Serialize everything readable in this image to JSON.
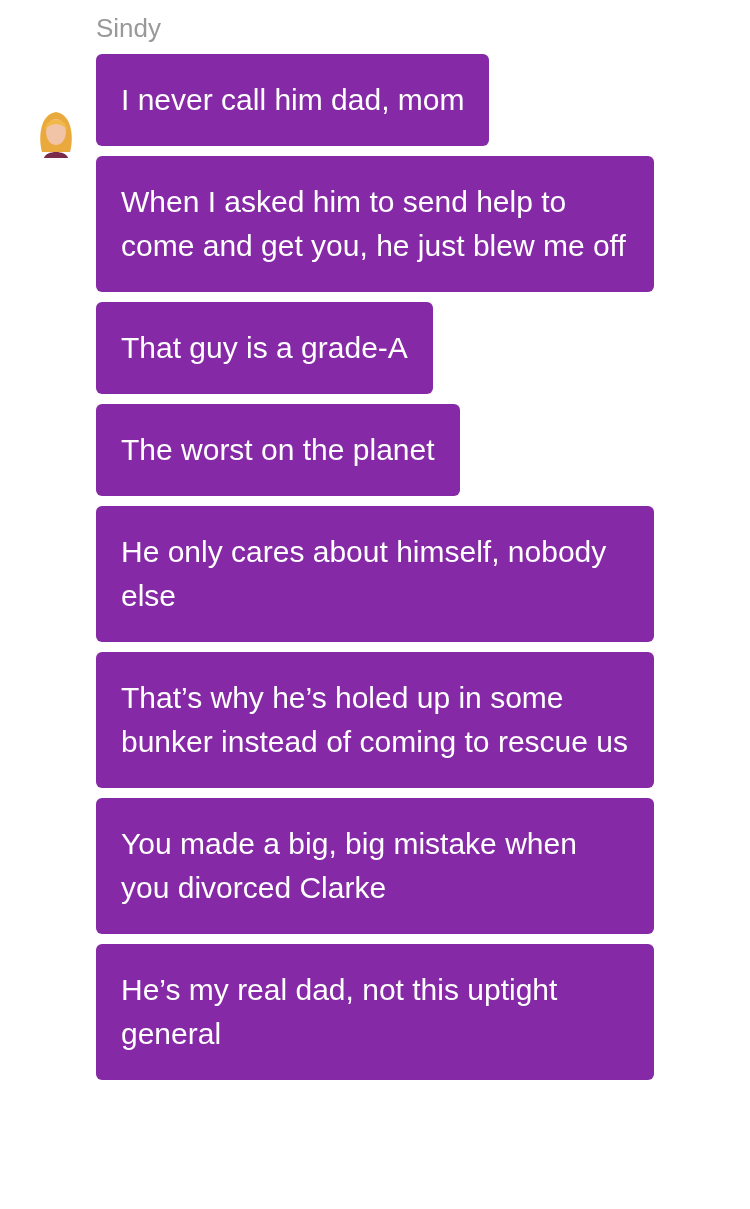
{
  "sender": {
    "name": "Sindy"
  },
  "messages": [
    {
      "text": "I never call him dad, mom"
    },
    {
      "text": "When I asked him to send help to come and get you, he just blew me off"
    },
    {
      "text": "That guy is a grade-A"
    },
    {
      "text": "The worst on the planet"
    },
    {
      "text": "He only cares about himself, nobody else"
    },
    {
      "text": "That’s why he’s holed up in some bunker instead of coming to rescue us"
    },
    {
      "text": "You made a big, big mistake when you divorced Clarke"
    },
    {
      "text": "He’s my real dad, not this uptight general"
    }
  ]
}
